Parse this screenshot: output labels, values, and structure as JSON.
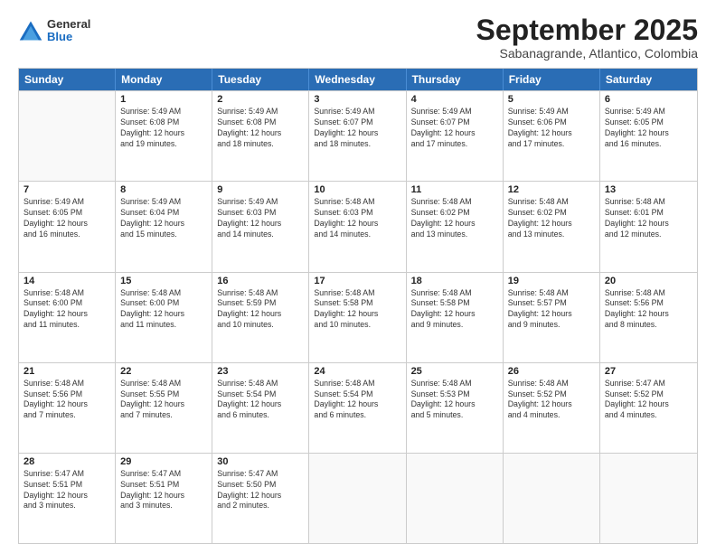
{
  "header": {
    "logo": {
      "general": "General",
      "blue": "Blue"
    },
    "title": "September 2025",
    "subtitle": "Sabanagrande, Atlantico, Colombia"
  },
  "weekdays": [
    "Sunday",
    "Monday",
    "Tuesday",
    "Wednesday",
    "Thursday",
    "Friday",
    "Saturday"
  ],
  "rows": [
    [
      {
        "day": "",
        "info": ""
      },
      {
        "day": "1",
        "info": "Sunrise: 5:49 AM\nSunset: 6:08 PM\nDaylight: 12 hours\nand 19 minutes."
      },
      {
        "day": "2",
        "info": "Sunrise: 5:49 AM\nSunset: 6:08 PM\nDaylight: 12 hours\nand 18 minutes."
      },
      {
        "day": "3",
        "info": "Sunrise: 5:49 AM\nSunset: 6:07 PM\nDaylight: 12 hours\nand 18 minutes."
      },
      {
        "day": "4",
        "info": "Sunrise: 5:49 AM\nSunset: 6:07 PM\nDaylight: 12 hours\nand 17 minutes."
      },
      {
        "day": "5",
        "info": "Sunrise: 5:49 AM\nSunset: 6:06 PM\nDaylight: 12 hours\nand 17 minutes."
      },
      {
        "day": "6",
        "info": "Sunrise: 5:49 AM\nSunset: 6:05 PM\nDaylight: 12 hours\nand 16 minutes."
      }
    ],
    [
      {
        "day": "7",
        "info": "Sunrise: 5:49 AM\nSunset: 6:05 PM\nDaylight: 12 hours\nand 16 minutes."
      },
      {
        "day": "8",
        "info": "Sunrise: 5:49 AM\nSunset: 6:04 PM\nDaylight: 12 hours\nand 15 minutes."
      },
      {
        "day": "9",
        "info": "Sunrise: 5:49 AM\nSunset: 6:03 PM\nDaylight: 12 hours\nand 14 minutes."
      },
      {
        "day": "10",
        "info": "Sunrise: 5:48 AM\nSunset: 6:03 PM\nDaylight: 12 hours\nand 14 minutes."
      },
      {
        "day": "11",
        "info": "Sunrise: 5:48 AM\nSunset: 6:02 PM\nDaylight: 12 hours\nand 13 minutes."
      },
      {
        "day": "12",
        "info": "Sunrise: 5:48 AM\nSunset: 6:02 PM\nDaylight: 12 hours\nand 13 minutes."
      },
      {
        "day": "13",
        "info": "Sunrise: 5:48 AM\nSunset: 6:01 PM\nDaylight: 12 hours\nand 12 minutes."
      }
    ],
    [
      {
        "day": "14",
        "info": "Sunrise: 5:48 AM\nSunset: 6:00 PM\nDaylight: 12 hours\nand 11 minutes."
      },
      {
        "day": "15",
        "info": "Sunrise: 5:48 AM\nSunset: 6:00 PM\nDaylight: 12 hours\nand 11 minutes."
      },
      {
        "day": "16",
        "info": "Sunrise: 5:48 AM\nSunset: 5:59 PM\nDaylight: 12 hours\nand 10 minutes."
      },
      {
        "day": "17",
        "info": "Sunrise: 5:48 AM\nSunset: 5:58 PM\nDaylight: 12 hours\nand 10 minutes."
      },
      {
        "day": "18",
        "info": "Sunrise: 5:48 AM\nSunset: 5:58 PM\nDaylight: 12 hours\nand 9 minutes."
      },
      {
        "day": "19",
        "info": "Sunrise: 5:48 AM\nSunset: 5:57 PM\nDaylight: 12 hours\nand 9 minutes."
      },
      {
        "day": "20",
        "info": "Sunrise: 5:48 AM\nSunset: 5:56 PM\nDaylight: 12 hours\nand 8 minutes."
      }
    ],
    [
      {
        "day": "21",
        "info": "Sunrise: 5:48 AM\nSunset: 5:56 PM\nDaylight: 12 hours\nand 7 minutes."
      },
      {
        "day": "22",
        "info": "Sunrise: 5:48 AM\nSunset: 5:55 PM\nDaylight: 12 hours\nand 7 minutes."
      },
      {
        "day": "23",
        "info": "Sunrise: 5:48 AM\nSunset: 5:54 PM\nDaylight: 12 hours\nand 6 minutes."
      },
      {
        "day": "24",
        "info": "Sunrise: 5:48 AM\nSunset: 5:54 PM\nDaylight: 12 hours\nand 6 minutes."
      },
      {
        "day": "25",
        "info": "Sunrise: 5:48 AM\nSunset: 5:53 PM\nDaylight: 12 hours\nand 5 minutes."
      },
      {
        "day": "26",
        "info": "Sunrise: 5:48 AM\nSunset: 5:52 PM\nDaylight: 12 hours\nand 4 minutes."
      },
      {
        "day": "27",
        "info": "Sunrise: 5:47 AM\nSunset: 5:52 PM\nDaylight: 12 hours\nand 4 minutes."
      }
    ],
    [
      {
        "day": "28",
        "info": "Sunrise: 5:47 AM\nSunset: 5:51 PM\nDaylight: 12 hours\nand 3 minutes."
      },
      {
        "day": "29",
        "info": "Sunrise: 5:47 AM\nSunset: 5:51 PM\nDaylight: 12 hours\nand 3 minutes."
      },
      {
        "day": "30",
        "info": "Sunrise: 5:47 AM\nSunset: 5:50 PM\nDaylight: 12 hours\nand 2 minutes."
      },
      {
        "day": "",
        "info": ""
      },
      {
        "day": "",
        "info": ""
      },
      {
        "day": "",
        "info": ""
      },
      {
        "day": "",
        "info": ""
      }
    ]
  ]
}
